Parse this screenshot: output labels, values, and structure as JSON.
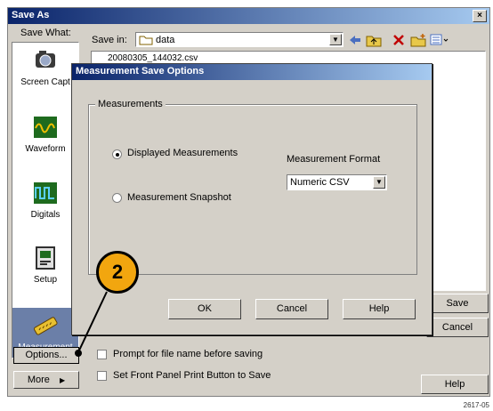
{
  "window": {
    "title": "Save As",
    "close_glyph": "×"
  },
  "save_what_label": "Save What:",
  "save_in": {
    "label": "Save in:",
    "folder": "data"
  },
  "file_entry": "20080305_144032.csv",
  "sidebar": {
    "items": [
      {
        "label": "Screen Capt",
        "icon": "screen-capture-icon"
      },
      {
        "label": "Waveform",
        "icon": "waveform-icon"
      },
      {
        "label": "Digitals",
        "icon": "digitals-icon"
      },
      {
        "label": "Setup",
        "icon": "setup-icon"
      },
      {
        "label": "Measurement",
        "icon": "measurement-icon",
        "selected": true
      }
    ],
    "options_button": "Options...",
    "more_button": "More",
    "more_glyph": "▶"
  },
  "checkboxes": {
    "prompt_label": "Prompt for file name before saving",
    "front_panel_label": "Set Front Panel Print Button to Save"
  },
  "right_buttons": {
    "save": "Save",
    "cancel": "Cancel",
    "help": "Help"
  },
  "dialog": {
    "title": "Measurement Save Options",
    "group_label": "Measurements",
    "radio_displayed": "Displayed Measurements",
    "radio_snapshot": "Measurement Snapshot",
    "format_label": "Measurement Format",
    "format_value": "Numeric CSV",
    "ok": "OK",
    "cancel": "Cancel",
    "help": "Help"
  },
  "callout_number": "2",
  "figure_id": "2617-05",
  "colors": {
    "titlebar_dark": "#0a246a",
    "titlebar_light": "#a6caf0",
    "callout": "#f2a60f"
  }
}
